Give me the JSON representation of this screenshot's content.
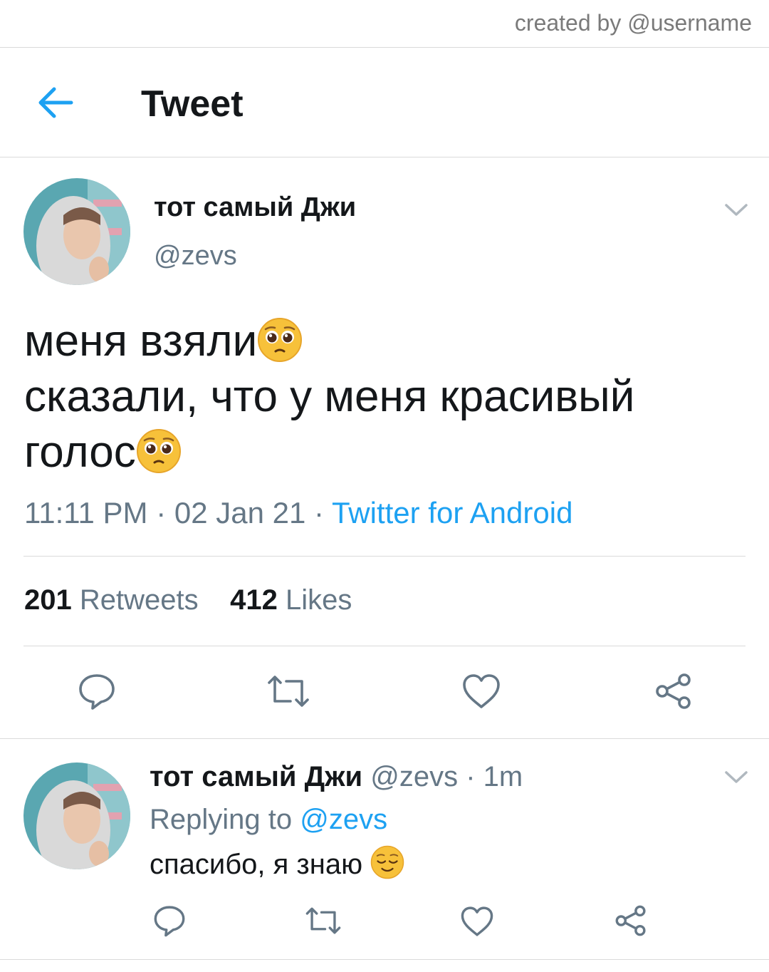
{
  "credit": "created by @username",
  "header": {
    "title": "Tweet",
    "back_icon": "arrow-left-icon",
    "accent": "#1da1f2"
  },
  "tweet": {
    "author_name": "тот самый Джи",
    "author_handle": "@zevs",
    "text_lines": [
      "меня взяли",
      "сказали, что у меня красивый",
      "голос"
    ],
    "emoji": "pleading-face",
    "time": "11:11 PM",
    "sep1": " · ",
    "date": "02 Jan 21",
    "sep2": " · ",
    "source": "Twitter for Android",
    "retweets_count": "201",
    "retweets_label": "Retweets",
    "likes_count": "412",
    "likes_label": "Likes"
  },
  "reply": {
    "author_name": "тот самый Джи",
    "author_handle": "@zevs",
    "sep": " · ",
    "time": "1m",
    "replying_label": "Replying to",
    "replying_to": "@zevs",
    "text": "спасибо, я знаю",
    "emoji": "relieved-face"
  },
  "colors": {
    "text": "#14171a",
    "secondary": "#657786",
    "link": "#1da1f2",
    "divider": "#dadada",
    "icon": "#657786"
  }
}
